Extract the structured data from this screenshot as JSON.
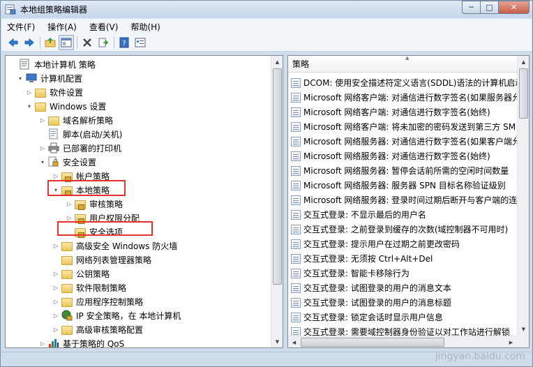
{
  "window": {
    "title": "本地组策略编辑器",
    "minimize_glyph": "─",
    "maximize_glyph": "□",
    "close_glyph": "✕"
  },
  "menu": [
    "文件(F)",
    "操作(A)",
    "查看(V)",
    "帮助(H)"
  ],
  "toolbar_icons": [
    "back-arrow-icon",
    "forward-arrow-icon",
    "up-folder-icon",
    "show-hide-tree-icon",
    "delete-icon",
    "export-list-icon",
    "help-icon",
    "properties-icon"
  ],
  "tree": [
    {
      "label": "本地计算机 策略",
      "expander": "",
      "icon": "computer-policy-icon"
    },
    {
      "label": "计算机配置",
      "expander": "▾",
      "icon": "computer-icon"
    },
    {
      "label": "软件设置",
      "expander": "▷",
      "icon": "folder-icon"
    },
    {
      "label": "Windows 设置",
      "expander": "▾",
      "icon": "folder-icon"
    },
    {
      "label": "域名解析策略",
      "expander": "▷",
      "icon": "folder-icon"
    },
    {
      "label": "脚本(启动/关机)",
      "expander": "",
      "icon": "script-icon"
    },
    {
      "label": "已部署的打印机",
      "expander": "▷",
      "icon": "printer-icon"
    },
    {
      "label": "安全设置",
      "expander": "▾",
      "icon": "security-settings-icon"
    },
    {
      "label": "帐户策略",
      "expander": "▷",
      "icon": "lock-folder-icon"
    },
    {
      "label": "本地策略",
      "expander": "▾",
      "icon": "lock-folder-icon"
    },
    {
      "label": "审核策略",
      "expander": "▷",
      "icon": "lock-folder-icon"
    },
    {
      "label": "用户权限分配",
      "expander": "▷",
      "icon": "lock-folder-icon"
    },
    {
      "label": "安全选项",
      "expander": "",
      "icon": "lock-folder-icon"
    },
    {
      "label": "高级安全 Windows 防火墙",
      "expander": "▷",
      "icon": "folder-icon"
    },
    {
      "label": "网络列表管理器策略",
      "expander": "",
      "icon": "folder-icon"
    },
    {
      "label": "公钥策略",
      "expander": "▷",
      "icon": "folder-icon"
    },
    {
      "label": "软件限制策略",
      "expander": "▷",
      "icon": "folder-icon"
    },
    {
      "label": "应用程序控制策略",
      "expander": "▷",
      "icon": "folder-icon"
    },
    {
      "label": "IP 安全策略，在 本地计算机",
      "expander": "▷",
      "icon": "ip-security-icon"
    },
    {
      "label": "高级审核策略配置",
      "expander": "▷",
      "icon": "folder-icon"
    },
    {
      "label": "基于策略的 QoS",
      "expander": "▷",
      "icon": "qos-chart-icon"
    }
  ],
  "list": {
    "column_header": "策略",
    "rows": [
      "DCOM: 使用安全描述符定义语言(SDDL)语法的计算机启动",
      "Microsoft 网络客户端: 对通信进行数字签名(如果服务器允",
      "Microsoft 网络客户端: 对通信进行数字签名(始终)",
      "Microsoft 网络客户端: 将未加密的密码发送到第三方 SM",
      "Microsoft 网络服务器: 对通信进行数字签名(如果客户端允",
      "Microsoft 网络服务器: 对通信进行数字签名(始终)",
      "Microsoft 网络服务器: 暂停会话前所需的空闲时间数量",
      "Microsoft 网络服务器: 服务器 SPN 目标名称验证级别",
      "Microsoft 网络服务器: 登录时间过期后断开与客户端的连",
      "交互式登录: 不显示最后的用户名",
      "交互式登录: 之前登录到缓存的次数(域控制器不可用时)",
      "交互式登录: 提示用户在过期之前更改密码",
      "交互式登录: 无须按 Ctrl+Alt+Del",
      "交互式登录: 智能卡移除行为",
      "交互式登录: 试图登录的用户的消息文本",
      "交互式登录: 试图登录的用户的消息标题",
      "交互式登录: 锁定会话时显示用户信息",
      "交互式登录: 需要域控制器身份验证以对工作站进行解锁"
    ]
  },
  "watermark": "jingyan.baidu.com",
  "colors": {
    "highlight_box": "#e5322e",
    "window_frame": "#cfdcec"
  }
}
